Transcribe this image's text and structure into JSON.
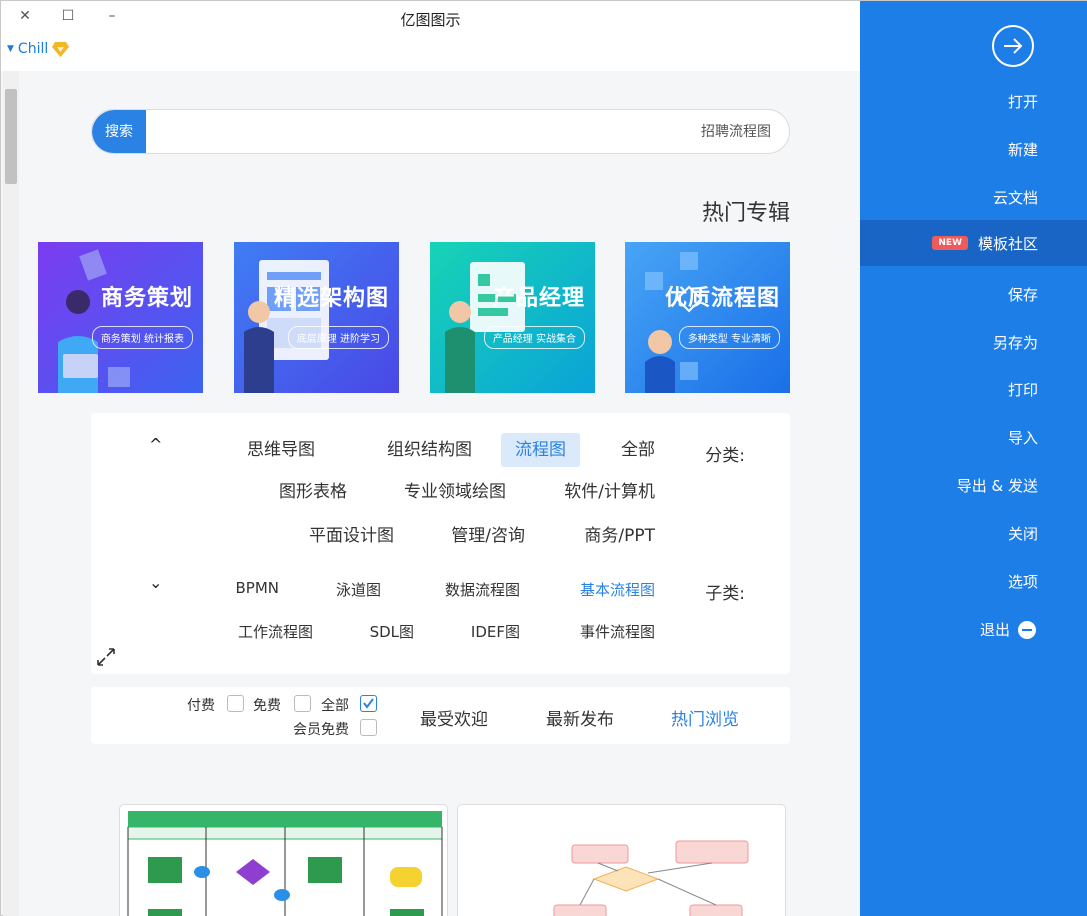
{
  "window": {
    "title": "亿图图示",
    "minimize": "–",
    "maximize": "☐",
    "close": "✕"
  },
  "user": {
    "name": "Chill"
  },
  "search": {
    "button": "搜索",
    "placeholder": "招聘流程图"
  },
  "hot_topics": {
    "title": "热门专辑",
    "banners": [
      {
        "title": "优质流程图",
        "subtitle": "多种类型 专业清晰"
      },
      {
        "title": "产品经理",
        "subtitle": "产品经理 实战集合"
      },
      {
        "title": "精选架构图",
        "subtitle": "底层原理 进阶学习"
      },
      {
        "title": "商务策划",
        "subtitle": "商务策划 统计报表"
      }
    ]
  },
  "filter": {
    "category_label": "分类:",
    "categories": [
      "全部",
      "流程图",
      "组织结构图",
      "思维导图",
      "软件/计算机",
      "专业领域绘图",
      "图形表格",
      "商务/PPT",
      "管理/咨询",
      "平面设计图"
    ],
    "subcategory_label": "子类:",
    "subcategories": [
      "基本流程图",
      "数据流程图",
      "泳道图",
      "BPMN",
      "事件流程图",
      "IDEF图",
      "SDL图",
      "工作流程图"
    ],
    "collapse": "^",
    "expand": "⌄"
  },
  "sort": {
    "options": [
      "热门浏览",
      "最新发布",
      "最受欢迎"
    ],
    "checkboxes": [
      "全部",
      "免费",
      "付费",
      "会员免费"
    ]
  },
  "sidebar": {
    "items": [
      "打开",
      "新建",
      "云文档",
      "模板社区",
      "保存",
      "另存为",
      "打印",
      "导入",
      "导出 & 发送",
      "关闭",
      "选项",
      "退出"
    ],
    "new_badge": "NEW"
  },
  "colors": {
    "accent": "#1e7ee8",
    "link": "#2a82e4",
    "badge": "#f05a5a"
  }
}
